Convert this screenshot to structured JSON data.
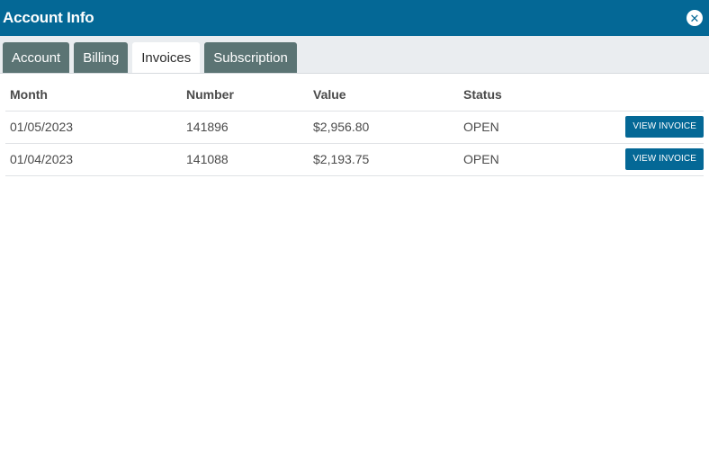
{
  "window": {
    "title": "Account Info",
    "close_icon": "close-icon"
  },
  "tabs": [
    {
      "label": "Account",
      "active": false
    },
    {
      "label": "Billing",
      "active": false
    },
    {
      "label": "Invoices",
      "active": true
    },
    {
      "label": "Subscription",
      "active": false
    }
  ],
  "invoices": {
    "columns": [
      "Month",
      "Number",
      "Value",
      "Status"
    ],
    "rows": [
      {
        "month": "01/05/2023",
        "number": "141896",
        "value": "$2,956.80",
        "status": "OPEN",
        "action": "VIEW INVOICE"
      },
      {
        "month": "01/04/2023",
        "number": "141088",
        "value": "$2,193.75",
        "status": "OPEN",
        "action": "VIEW INVOICE"
      }
    ]
  },
  "colors": {
    "accent": "#046896",
    "tab_inactive": "#5b7474",
    "tabbar_bg": "#eaedf0"
  }
}
